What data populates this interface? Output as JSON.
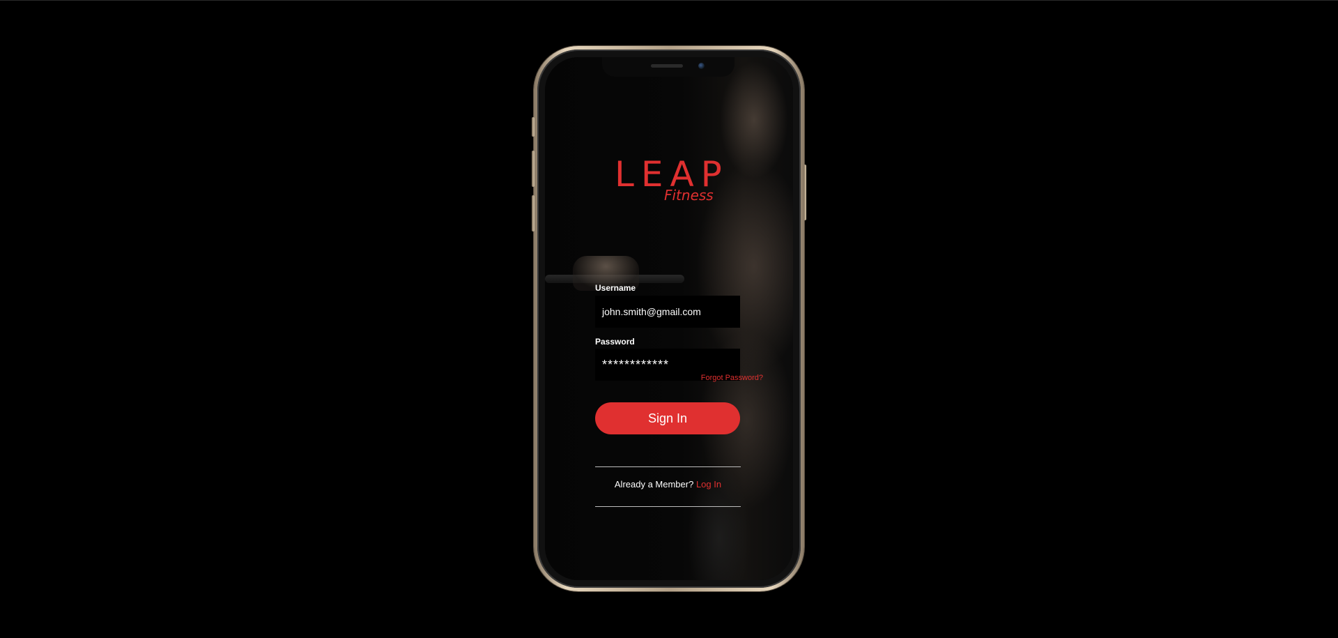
{
  "brand": {
    "title": "LEAP",
    "subtitle": "Fitness"
  },
  "form": {
    "username_label": "Username",
    "username_value": "john.smith@gmail.com",
    "password_label": "Password",
    "password_value": "************",
    "forgot_label": "Forgot Password?",
    "signin_label": "Sign In"
  },
  "footer": {
    "prompt": "Already a Member?",
    "login_label": "Log In"
  },
  "colors": {
    "accent": "#e03030",
    "background": "#000000",
    "text": "#ffffff",
    "phone_frame": "#d8c7ab"
  }
}
